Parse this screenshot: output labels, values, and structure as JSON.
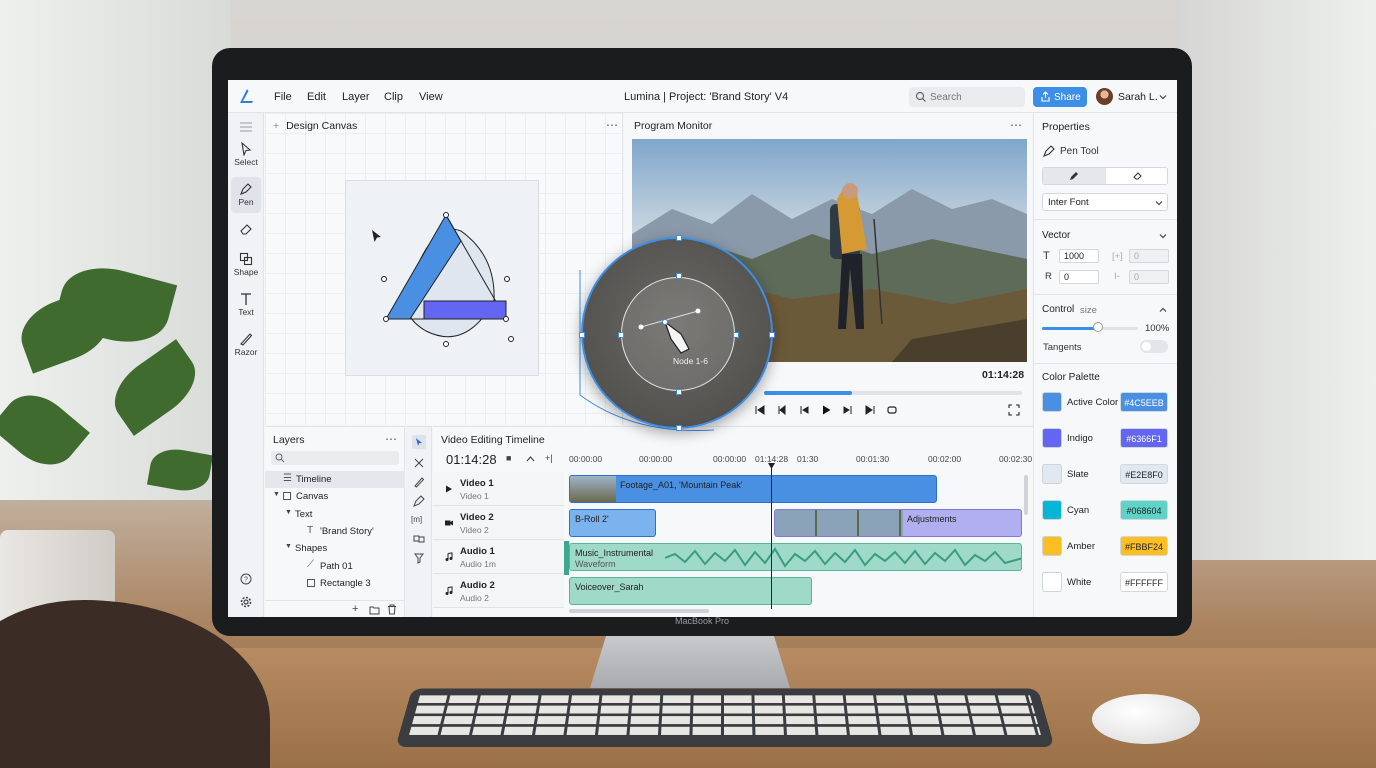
{
  "device": {
    "label": "MacBook Pro"
  },
  "menubar": {
    "menus": [
      "File",
      "Edit",
      "Layer",
      "Clip",
      "View"
    ],
    "title": "Lumina | Project: 'Brand Story' V4",
    "search_placeholder": "Search",
    "share_label": "Share",
    "user_name": "Sarah L."
  },
  "toolbar": {
    "tools": [
      {
        "label": "Select",
        "icon": "cursor-icon"
      },
      {
        "label": "Pen",
        "icon": "pen-icon"
      },
      {
        "label": "",
        "icon": "eraser-icon"
      },
      {
        "label": "Shape",
        "icon": "shape-icon"
      },
      {
        "label": "Text",
        "icon": "text-icon"
      },
      {
        "label": "Razor",
        "icon": "razor-icon"
      }
    ],
    "active": "Pen"
  },
  "design_canvas": {
    "title": "Design Canvas"
  },
  "program_monitor": {
    "title": "Program Monitor",
    "timecode": "01:14:28",
    "playhead_fraction": 0.34
  },
  "magnifier": {
    "label": "Node 1-6"
  },
  "properties": {
    "title": "Properties",
    "tool": "Pen Tool",
    "font": "Inter Font",
    "vector": {
      "title": "Vector",
      "t_value": "1000",
      "r_value": "0",
      "x_value": "0",
      "y_value": "0"
    },
    "control": {
      "title": "Control",
      "size_label": "size",
      "size_value": "100%",
      "size_fraction": 0.58,
      "tangents_label": "Tangents",
      "tangents_on": false
    },
    "palette_title": "Color Palette",
    "palette": [
      {
        "name": "Active Color",
        "hex": "#4C5EEB",
        "color": "#4a90e2",
        "chip": "#4a90e2",
        "chip_text": "#ffffff"
      },
      {
        "name": "Indigo",
        "hex": "#6366F1",
        "color": "#6366f1",
        "chip": "#6366f1",
        "chip_text": "#ffffff"
      },
      {
        "name": "Slate",
        "hex": "#E2E8F0",
        "color": "#e2e8f0",
        "chip": "#e2e8f0",
        "chip_text": "#222222"
      },
      {
        "name": "Cyan",
        "hex": "#068604",
        "color": "#06b6d4",
        "chip": "#5fd3c8",
        "chip_text": "#222222"
      },
      {
        "name": "Amber",
        "hex": "#FBBF24",
        "color": "#fbbf24",
        "chip": "#fbbf24",
        "chip_text": "#222222"
      },
      {
        "name": "White",
        "hex": "#FFFFFF",
        "color": "#ffffff",
        "chip": "#ffffff",
        "chip_text": "#222222"
      }
    ]
  },
  "layers": {
    "title": "Layers",
    "items": [
      {
        "label": "Timeline",
        "depth": 0,
        "icon": "list-icon",
        "selected": true
      },
      {
        "label": "Canvas",
        "depth": 0,
        "icon": "square-icon",
        "selected": false
      },
      {
        "label": "Text",
        "depth": 1,
        "icon": "",
        "selected": false
      },
      {
        "label": "'Brand Story'",
        "depth": 2,
        "icon": "text-icon",
        "selected": false
      },
      {
        "label": "Shapes",
        "depth": 1,
        "icon": "",
        "selected": false
      },
      {
        "label": "Path 01",
        "depth": 2,
        "icon": "path-icon",
        "selected": false
      },
      {
        "label": "Rectangle 3",
        "depth": 2,
        "icon": "square-icon",
        "selected": false
      }
    ]
  },
  "timeline": {
    "title": "Video Editing Timeline",
    "timecode": "01:14:28",
    "ruler": [
      "00:00:00",
      "00:00:00",
      "00:00:00",
      "01:14:28",
      "01:30",
      "00:01:30",
      "00:02:00",
      "00:02:30"
    ],
    "tracks": [
      {
        "name": "Video 1",
        "sub": "Video 1",
        "icon": "play-icon"
      },
      {
        "name": "Video 2",
        "sub": "Video 2",
        "icon": "camera-icon"
      },
      {
        "name": "Audio 1",
        "sub": "Audio 1m",
        "icon": "music-icon"
      },
      {
        "name": "Audio 2",
        "sub": "Audio 2",
        "icon": "music-icon"
      }
    ],
    "clips": {
      "footage": "Footage_A01, 'Mountain Peak'",
      "broll": "B-Roll 2'",
      "adjustments": "Adjustments",
      "music": "Music_Instrumental",
      "music_sub": "Waveform",
      "voiceover": "Voiceover_Sarah"
    }
  }
}
